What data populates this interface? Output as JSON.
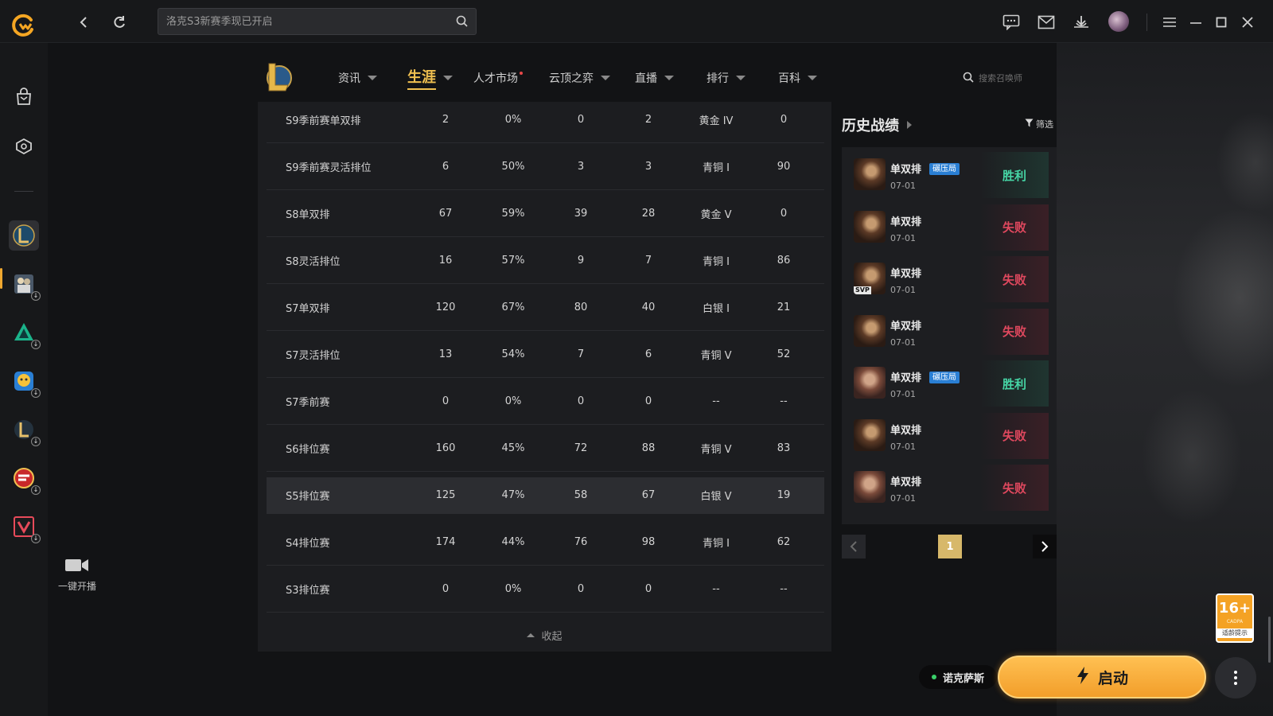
{
  "search": {
    "placeholder": "洛克S3新赛季现已开启"
  },
  "game_nav": {
    "tabs": [
      {
        "label": "资讯",
        "dropdown": true
      },
      {
        "label": "生涯",
        "dropdown": true,
        "active": true
      },
      {
        "label": "人才市场",
        "dropdown": false,
        "dot": true
      },
      {
        "label": "云顶之弈",
        "dropdown": true
      },
      {
        "label": "直播",
        "dropdown": true
      },
      {
        "label": "排行",
        "dropdown": true
      },
      {
        "label": "百科",
        "dropdown": true
      }
    ],
    "summoner_search_placeholder": "搜索召唤师"
  },
  "broadcast": {
    "label": "一键开播"
  },
  "seasons": [
    {
      "name": "S9季前赛单双排",
      "games": "2",
      "winrate": "0%",
      "wins": "0",
      "losses": "2",
      "tier": "黄金 IV",
      "points": "0"
    },
    {
      "name": "S9季前赛灵活排位",
      "games": "6",
      "winrate": "50%",
      "wins": "3",
      "losses": "3",
      "tier": "青铜 I",
      "points": "90"
    },
    {
      "name": "S8单双排",
      "games": "67",
      "winrate": "59%",
      "wins": "39",
      "losses": "28",
      "tier": "黄金 V",
      "points": "0"
    },
    {
      "name": "S8灵活排位",
      "games": "16",
      "winrate": "57%",
      "wins": "9",
      "losses": "7",
      "tier": "青铜 I",
      "points": "86"
    },
    {
      "name": "S7单双排",
      "games": "120",
      "winrate": "67%",
      "wins": "80",
      "losses": "40",
      "tier": "白银 I",
      "points": "21"
    },
    {
      "name": "S7灵活排位",
      "games": "13",
      "winrate": "54%",
      "wins": "7",
      "losses": "6",
      "tier": "青铜 V",
      "points": "52"
    },
    {
      "name": "S7季前赛",
      "games": "0",
      "winrate": "0%",
      "wins": "0",
      "losses": "0",
      "tier": "--",
      "points": "--"
    },
    {
      "name": "S6排位赛",
      "games": "160",
      "winrate": "45%",
      "wins": "72",
      "losses": "88",
      "tier": "青铜 V",
      "points": "83"
    },
    {
      "name": "S5排位赛",
      "games": "125",
      "winrate": "47%",
      "wins": "58",
      "losses": "67",
      "tier": "白银 V",
      "points": "19",
      "highlighted": true
    },
    {
      "name": "S4排位赛",
      "games": "174",
      "winrate": "44%",
      "wins": "76",
      "losses": "98",
      "tier": "青铜 I",
      "points": "62"
    },
    {
      "name": "S3排位赛",
      "games": "0",
      "winrate": "0%",
      "wins": "0",
      "losses": "0",
      "tier": "--",
      "points": "--"
    }
  ],
  "collapse_label": "收起",
  "history": {
    "title": "历史战绩",
    "filter_label": "筛选",
    "matches": [
      {
        "mode": "单双排",
        "tag": "碾压局",
        "date": "07-01",
        "result": "胜利",
        "outcome": "win",
        "svp": ""
      },
      {
        "mode": "单双排",
        "tag": "",
        "date": "07-01",
        "result": "失败",
        "outcome": "loss",
        "svp": ""
      },
      {
        "mode": "单双排",
        "tag": "",
        "date": "07-01",
        "result": "失败",
        "outcome": "loss",
        "svp": "SVP"
      },
      {
        "mode": "单双排",
        "tag": "",
        "date": "07-01",
        "result": "失败",
        "outcome": "loss",
        "svp": ""
      },
      {
        "mode": "单双排",
        "tag": "碾压局",
        "date": "07-01",
        "result": "胜利",
        "outcome": "win",
        "svp": ""
      },
      {
        "mode": "单双排",
        "tag": "",
        "date": "07-01",
        "result": "失败",
        "outcome": "loss",
        "svp": ""
      },
      {
        "mode": "单双排",
        "tag": "",
        "date": "07-01",
        "result": "失败",
        "outcome": "loss",
        "svp": ""
      }
    ],
    "page": "1"
  },
  "age_badge": {
    "age": "16+",
    "cadpa": "CADPA",
    "tip": "适龄提示"
  },
  "server": {
    "name": "诺克萨斯"
  },
  "launch_label": "启动",
  "colors": {
    "accent_gold": "#f0c050",
    "launch_orange": "#f29e2a",
    "win_green": "#46d6a6",
    "loss_red": "#e0485e",
    "tag_blue": "#2a7fd4"
  }
}
